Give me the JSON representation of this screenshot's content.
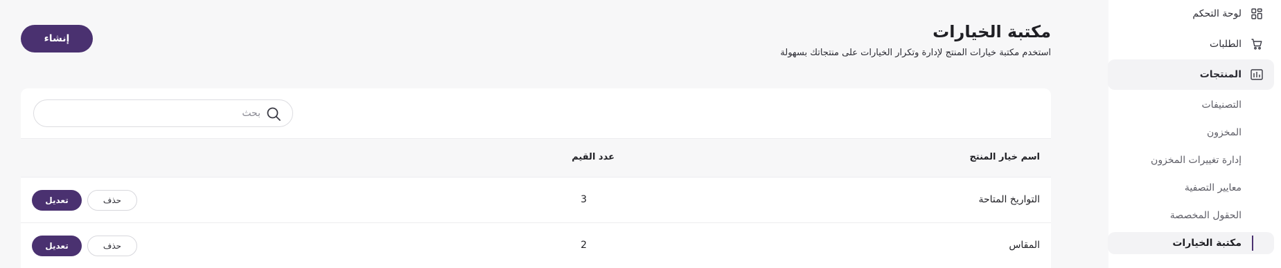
{
  "sidebar": {
    "items": [
      {
        "label": "لوحة التحكم",
        "icon": "dashboard-icon"
      },
      {
        "label": "الطلبات",
        "icon": "cart-icon"
      },
      {
        "label": "المنتجات",
        "icon": "products-icon",
        "active": true
      }
    ],
    "sub_items": [
      {
        "label": "التصنيفات"
      },
      {
        "label": "المخزون"
      },
      {
        "label": "إدارة تغييرات المخزون"
      },
      {
        "label": "معايير التصفية"
      },
      {
        "label": "الحقول المخصصة"
      },
      {
        "label": "مكتبة الخيارات",
        "active": true
      }
    ]
  },
  "header": {
    "title": "مكتبة الخيارات",
    "subtitle": "استخدم مكتبة خيارات المنتج لإدارة وتكرار الخيارات على منتجاتك بسهولة",
    "create_label": "إنشاء"
  },
  "search": {
    "placeholder": "بحث",
    "value": ""
  },
  "table": {
    "columns": [
      "اسم خيار المنتج",
      "عدد القيم"
    ],
    "rows": [
      {
        "name": "التواريخ المتاحة",
        "count": "3"
      },
      {
        "name": "المقاس",
        "count": "2"
      }
    ],
    "edit_label": "تعديل",
    "delete_label": "حذف"
  },
  "colors": {
    "accent": "#4a3170",
    "background": "#f7f7f8",
    "surface": "#ffffff"
  }
}
